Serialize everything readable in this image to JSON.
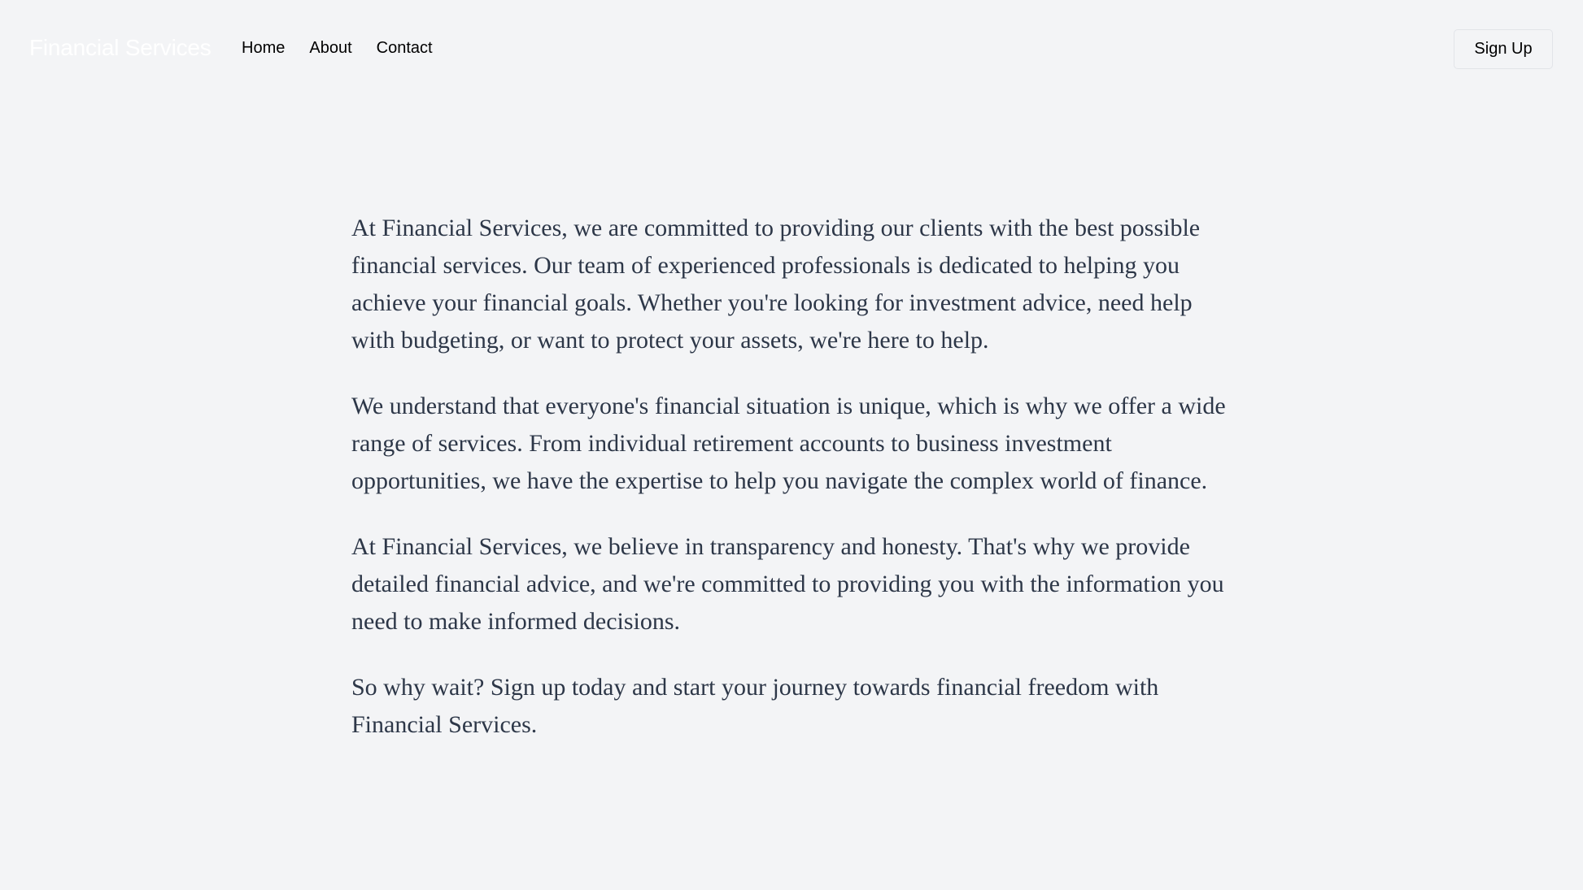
{
  "header": {
    "brand": "Financial Services",
    "nav": [
      {
        "label": "Home"
      },
      {
        "label": "About"
      },
      {
        "label": "Contact"
      }
    ],
    "signup_label": "Sign Up"
  },
  "main": {
    "paragraphs": [
      "At Financial Services, we are committed to providing our clients with the best possible financial services. Our team of experienced professionals is dedicated to helping you achieve your financial goals. Whether you're looking for investment advice, need help with budgeting, or want to protect your assets, we're here to help.",
      "We understand that everyone's financial situation is unique, which is why we offer a wide range of services. From individual retirement accounts to business investment opportunities, we have the expertise to help you navigate the complex world of finance.",
      "At Financial Services, we believe in transparency and honesty. That's why we provide detailed financial advice, and we're committed to providing you with the information you need to make informed decisions.",
      "So why wait? Sign up today and start your journey towards financial freedom with Financial Services."
    ]
  },
  "colors": {
    "background": "#f3f4f6",
    "brand_text": "#ffffff",
    "body_text": "#2d3748"
  }
}
